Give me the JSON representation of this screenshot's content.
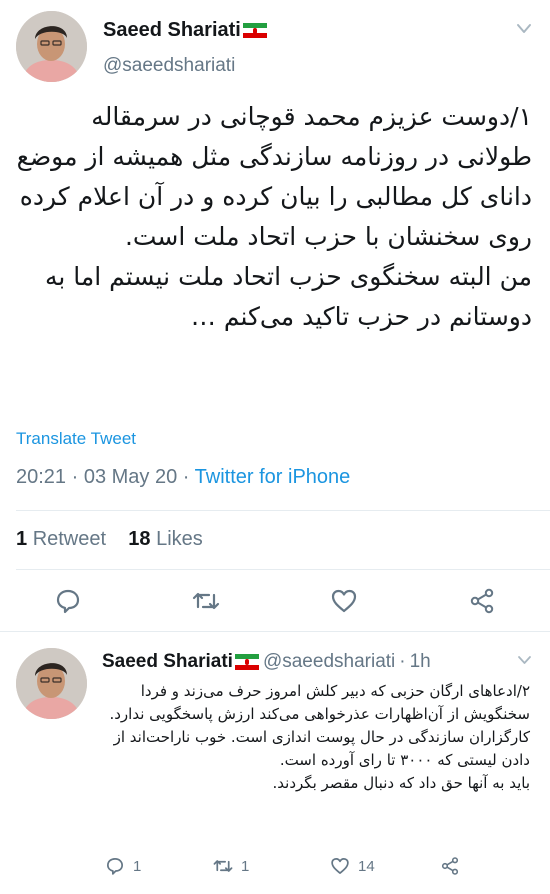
{
  "colors": {
    "link": "#1b95e0",
    "muted": "#657786",
    "text": "#14171a",
    "divider": "#e6ecf0"
  },
  "main_tweet": {
    "display_name": "Saeed Shariati",
    "handle": "@saeedshariati",
    "text": "۱/دوست عزیزم محمد قوچانی در سرمقاله طولانی در روزنامه سازندگی مثل همیشه از موضع دانای کل مطالبی را بیان کرده و در آن اعلام کرده روی سخنشان با حزب اتحاد ملت است.\nمن البته سخنگوی حزب اتحاد ملت نیستم اما به دوستانم در حزب تاکید می‌کنم …",
    "translate_label": "Translate Tweet",
    "time": "20:21",
    "date": "03 May 20",
    "source": "Twitter for iPhone",
    "retweet_count": "1",
    "retweet_label": "Retweet",
    "like_count": "18",
    "like_label": "Likes",
    "icons": [
      "reply-icon",
      "retweet-icon",
      "like-icon",
      "share-icon",
      "chevron-down-icon"
    ]
  },
  "reply_tweet": {
    "display_name": "Saeed Shariati",
    "handle": "@saeedshariati",
    "time_ago": "1h",
    "text": "۲/ادعاهای ارگان حزبی که دبیر کلش امروز حرف می‌زند و فردا سخنگویش از آن‌اظهارات عذرخواهی می‌کند ارزش پاسخگویی ندارد.\nکارگزاران سازندگی در حال پوست اندازی است. خوب ناراحت‌اند از دادن لیستی که ۳۰۰۰ تا رای آورده است.\nباید به آنها حق داد که دنبال مقصر بگردند.",
    "reply_count": "1",
    "retweet_count": "1",
    "like_count": "14"
  }
}
